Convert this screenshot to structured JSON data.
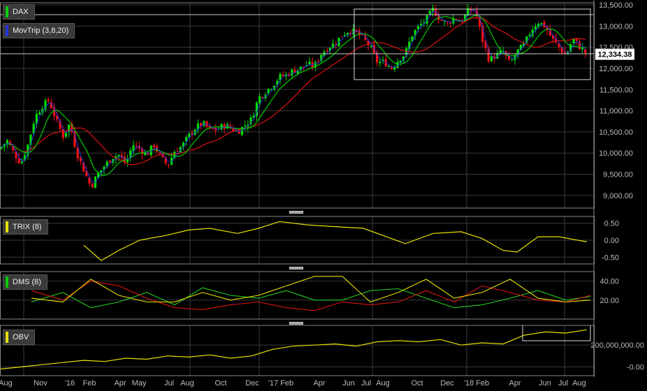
{
  "colors": {
    "background": "#000000",
    "up_candle": "#00dd00",
    "down_candle": "#ee1111",
    "ma_fast": "#00cc00",
    "ma_slow": "#dd1111",
    "trix": "#e8e000",
    "dms_green": "#22cc22",
    "dms_red": "#dd1111",
    "dms_yellow": "#e8e000",
    "obv": "#e8e000",
    "grid": "#3a3a3a",
    "axis_text": "#bbbbbb"
  },
  "panels": {
    "price": {
      "legend": "DAX",
      "legend_color": "#00cc00",
      "overlay_legend": "MovTrip (3,8,20)",
      "overlay_color": "#2233dd",
      "last_value_label": "12,334.38",
      "last_value": 12334.38
    },
    "trix": {
      "legend": "TRIX (8)",
      "legend_color": "#e8e000"
    },
    "dms": {
      "legend": "DMS (8)",
      "legend_color": "#00cc00"
    },
    "obv": {
      "legend": "OBV",
      "legend_color": "#e8e000"
    }
  },
  "chart_data": [
    {
      "type": "candlestick",
      "title": "DAX",
      "overlay": "MovTrip (3,8,20)",
      "yticks": [
        "13,500.00",
        "13,000.00",
        "12,500.00",
        "12,000.00",
        "11,500.00",
        "11,000.00",
        "10,500.00",
        "10,000.00",
        "9,500.00",
        "9,000.00"
      ],
      "ylim": [
        8700,
        13550
      ],
      "x_labels": [
        "Aug",
        "Nov",
        "'16",
        "Feb",
        "Apr",
        "May",
        "Jul",
        "Aug",
        "Oct",
        "Dec",
        "'17 Feb",
        "Apr",
        "Jun",
        "Jul",
        "Aug",
        "Oct",
        "Dec",
        "'18 Feb",
        "Apr",
        "Jun",
        "Jul",
        "Aug"
      ],
      "close_points": [
        [
          0,
          10100
        ],
        [
          10,
          10300
        ],
        [
          20,
          10000
        ],
        [
          30,
          9750
        ],
        [
          40,
          10200
        ],
        [
          50,
          10850
        ],
        [
          60,
          11100
        ],
        [
          70,
          11250
        ],
        [
          80,
          10800
        ],
        [
          90,
          10400
        ],
        [
          100,
          10700
        ],
        [
          110,
          10000
        ],
        [
          120,
          9600
        ],
        [
          130,
          9200
        ],
        [
          140,
          9500
        ],
        [
          150,
          9700
        ],
        [
          160,
          9900
        ],
        [
          170,
          9950
        ],
        [
          180,
          9750
        ],
        [
          190,
          10200
        ],
        [
          200,
          10100
        ],
        [
          210,
          9950
        ],
        [
          220,
          10200
        ],
        [
          230,
          9900
        ],
        [
          240,
          9700
        ],
        [
          250,
          10050
        ],
        [
          260,
          10150
        ],
        [
          270,
          10400
        ],
        [
          280,
          10600
        ],
        [
          290,
          10700
        ],
        [
          300,
          10550
        ],
        [
          310,
          10550
        ],
        [
          320,
          10650
        ],
        [
          330,
          10600
        ],
        [
          340,
          10500
        ],
        [
          350,
          10650
        ],
        [
          360,
          10800
        ],
        [
          370,
          11300
        ],
        [
          380,
          11450
        ],
        [
          390,
          11600
        ],
        [
          400,
          11800
        ],
        [
          410,
          11850
        ],
        [
          420,
          11950
        ],
        [
          430,
          12000
        ],
        [
          440,
          12100
        ],
        [
          450,
          12050
        ],
        [
          460,
          12350
        ],
        [
          470,
          12500
        ],
        [
          480,
          12600
        ],
        [
          490,
          12800
        ],
        [
          500,
          12900
        ],
        [
          510,
          12850
        ],
        [
          520,
          12700
        ],
        [
          530,
          12500
        ],
        [
          540,
          12150
        ],
        [
          550,
          12150
        ],
        [
          560,
          12000
        ],
        [
          570,
          12200
        ],
        [
          580,
          12350
        ],
        [
          590,
          12800
        ],
        [
          600,
          13000
        ],
        [
          610,
          13150
        ],
        [
          620,
          13400
        ],
        [
          630,
          13150
        ],
        [
          640,
          13050
        ],
        [
          650,
          13200
        ],
        [
          660,
          13100
        ],
        [
          670,
          13350
        ],
        [
          680,
          13400
        ],
        [
          690,
          12700
        ],
        [
          700,
          12200
        ],
        [
          710,
          12300
        ],
        [
          720,
          12400
        ],
        [
          730,
          12100
        ],
        [
          740,
          12400
        ],
        [
          750,
          12550
        ],
        [
          760,
          12900
        ],
        [
          770,
          13100
        ],
        [
          780,
          13000
        ],
        [
          790,
          12700
        ],
        [
          800,
          12500
        ],
        [
          810,
          12300
        ],
        [
          820,
          12700
        ],
        [
          830,
          12500
        ],
        [
          840,
          12334
        ]
      ],
      "extremes": [
        {
          "label": "low",
          "x": 135,
          "value": 8750
        },
        {
          "label": "high",
          "x": 685,
          "value": 13600
        }
      ]
    },
    {
      "type": "line",
      "title": "TRIX (8)",
      "yticks": [
        "0.50",
        "0.00",
        "-0.50"
      ],
      "ylim": [
        -0.7,
        0.7
      ],
      "x": [
        120,
        145,
        170,
        200,
        240,
        270,
        300,
        340,
        370,
        400,
        440,
        480,
        520,
        560,
        580,
        620,
        660,
        690,
        720,
        740,
        770,
        800,
        840
      ],
      "values": [
        -0.15,
        -0.6,
        -0.3,
        0.0,
        0.15,
        0.3,
        0.35,
        0.2,
        0.35,
        0.55,
        0.45,
        0.4,
        0.35,
        0.05,
        -0.1,
        0.2,
        0.25,
        0.05,
        -0.3,
        -0.35,
        0.1,
        0.1,
        -0.05
      ]
    },
    {
      "type": "line",
      "title": "DMS (8)",
      "yticks": [
        "40.00",
        "20.00"
      ],
      "ylim": [
        0,
        50
      ],
      "x": [
        45,
        90,
        130,
        170,
        210,
        250,
        290,
        330,
        370,
        410,
        450,
        490,
        530,
        570,
        610,
        650,
        690,
        730,
        770,
        810,
        845
      ],
      "series": [
        {
          "color": "#22cc22",
          "values": [
            18,
            28,
            12,
            18,
            28,
            15,
            33,
            25,
            22,
            30,
            20,
            20,
            30,
            32,
            22,
            12,
            15,
            22,
            30,
            20,
            24
          ]
        },
        {
          "color": "#dd1111",
          "values": [
            30,
            20,
            40,
            35,
            22,
            12,
            10,
            15,
            18,
            12,
            9,
            18,
            15,
            18,
            30,
            18,
            35,
            28,
            20,
            18,
            25
          ]
        },
        {
          "color": "#e8e000",
          "values": [
            22,
            18,
            42,
            25,
            18,
            18,
            28,
            20,
            25,
            35,
            45,
            45,
            18,
            28,
            42,
            22,
            28,
            42,
            22,
            18,
            20
          ]
        }
      ]
    },
    {
      "type": "line",
      "title": "OBV",
      "yticks": [
        "200,000,000.00",
        "-0.00"
      ],
      "ylim": [
        -80000000,
        380000000
      ],
      "x": [
        0,
        30,
        60,
        90,
        120,
        150,
        180,
        210,
        240,
        270,
        300,
        330,
        360,
        390,
        420,
        450,
        480,
        510,
        540,
        570,
        600,
        630,
        660,
        690,
        720,
        750,
        780,
        810,
        840
      ],
      "values": [
        -20000000,
        0,
        20000000,
        40000000,
        60000000,
        50000000,
        80000000,
        70000000,
        100000000,
        90000000,
        110000000,
        80000000,
        100000000,
        160000000,
        190000000,
        200000000,
        210000000,
        190000000,
        230000000,
        240000000,
        230000000,
        250000000,
        200000000,
        220000000,
        210000000,
        290000000,
        320000000,
        310000000,
        340000000
      ]
    }
  ]
}
